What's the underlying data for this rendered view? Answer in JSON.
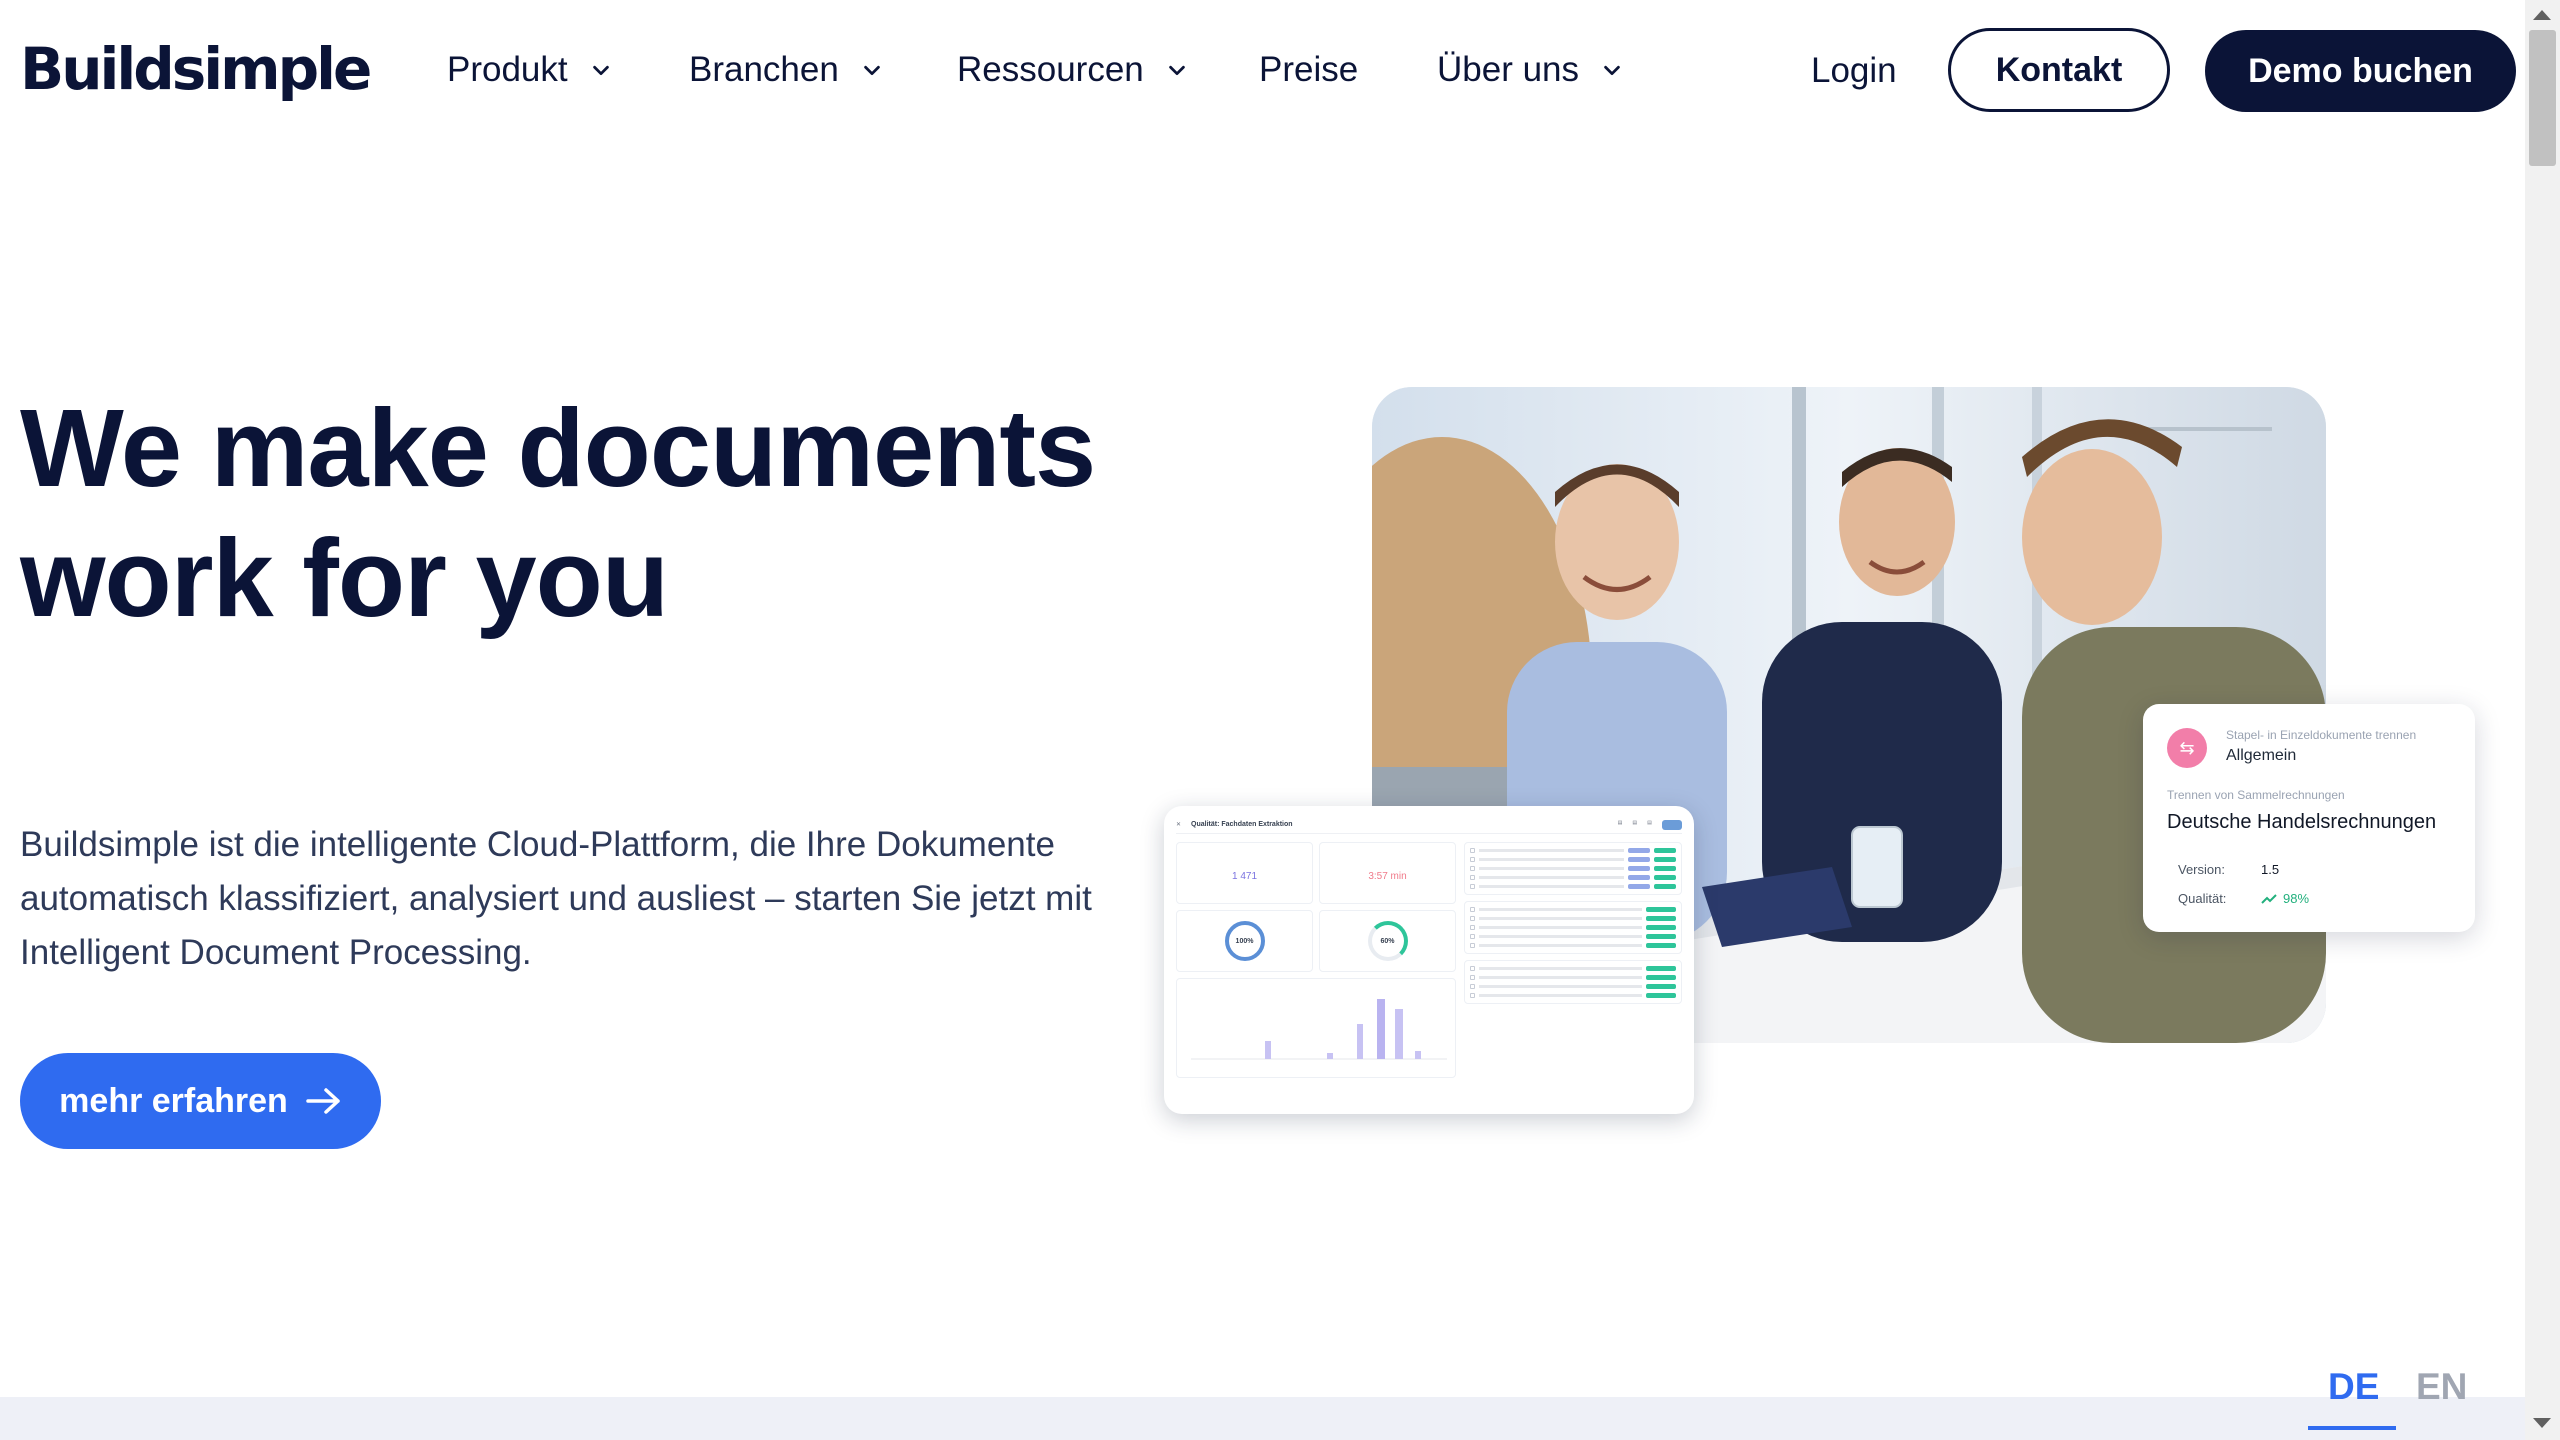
{
  "brand": {
    "logo_text": "Buildsimple"
  },
  "nav": {
    "items": [
      {
        "label": "Produkt",
        "has_dropdown": true
      },
      {
        "label": "Branchen",
        "has_dropdown": true
      },
      {
        "label": "Ressourcen",
        "has_dropdown": true
      },
      {
        "label": "Preise",
        "has_dropdown": false
      },
      {
        "label": "Über uns",
        "has_dropdown": true
      }
    ],
    "login": "Login",
    "contact": "Kontakt",
    "demo": "Demo buchen"
  },
  "hero": {
    "title": "We make documents work for you",
    "subtitle": "Buildsimple ist die intelligente Cloud-Plattform, die Ihre Dokumente automatisch klassifiziert, analysiert und ausliest – starten Sie jetzt mit Intelligent Document Processing.",
    "cta": "mehr erfahren"
  },
  "dashboard": {
    "title": "Qualität: Fachdaten Extraktion",
    "kpi_count": "1 471",
    "kpi_time": "3:57 min",
    "gauge_1": "100%",
    "gauge_2": "60%"
  },
  "doc_card": {
    "small_label": "Stapel- in Einzeldokumente trennen",
    "category": "Allgemein",
    "small_label_2": "Trennen von Sammelrechnungen",
    "name": "Deutsche Handelsrechnungen",
    "version_label": "Version:",
    "version_value": "1.5",
    "quality_label": "Qualität:",
    "quality_value": "98%"
  },
  "language": {
    "de": "DE",
    "en": "EN",
    "active": "DE"
  },
  "colors": {
    "navy": "#0b1437",
    "accent_blue": "#2f6bf0",
    "pink": "#f27ea9",
    "green": "#22b07d"
  }
}
